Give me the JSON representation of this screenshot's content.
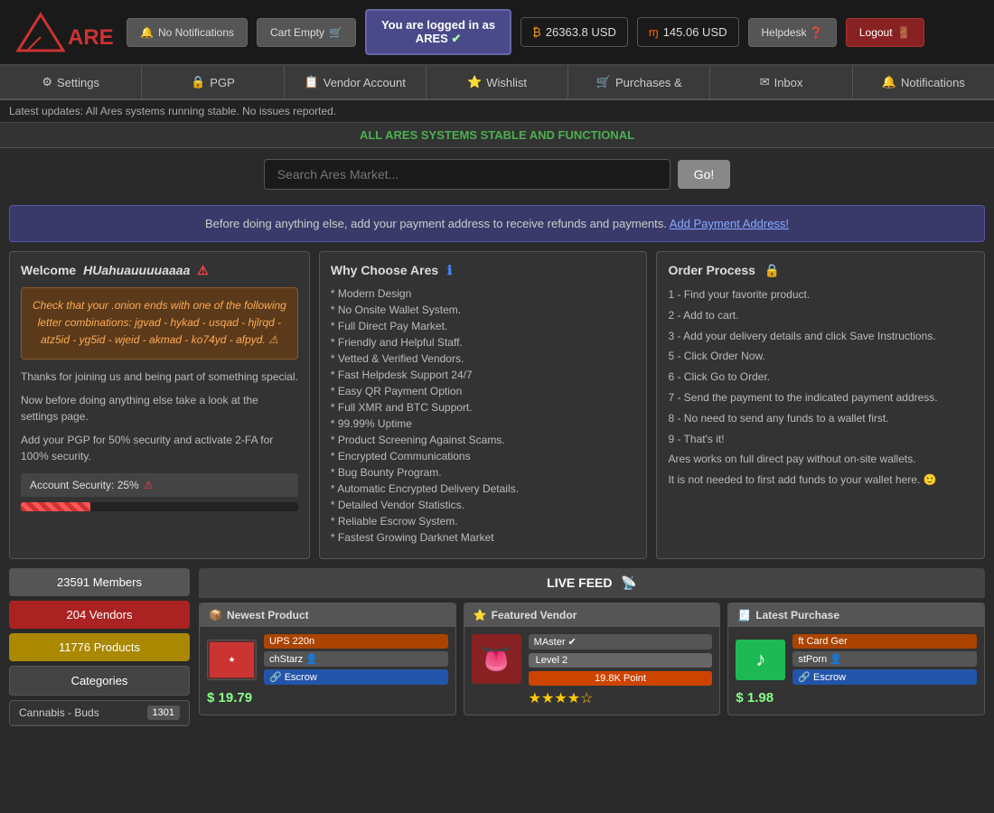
{
  "header": {
    "logo_text": "ARES",
    "notifications_label": "No Notifications",
    "cart_label": "Cart Empty",
    "logged_in_line1": "You are logged in as",
    "logged_in_line2": "ARES",
    "btc_balance": "26363.8 USD",
    "xmr_balance": "145.06 USD",
    "helpdesk_label": "Helpdesk",
    "logout_label": "Logout"
  },
  "nav": {
    "items": [
      {
        "label": "Settings",
        "icon": "⚙"
      },
      {
        "label": "PGP",
        "icon": "🔒"
      },
      {
        "label": "Vendor Account",
        "icon": "📋"
      },
      {
        "label": "Wishlist",
        "icon": "⭐"
      },
      {
        "label": "Purchases &",
        "icon": "🛒"
      },
      {
        "label": "Inbox",
        "icon": "✉"
      },
      {
        "label": "Notifications",
        "icon": "🔔"
      }
    ]
  },
  "ticker": {
    "text": "Latest updates: All Ares systems running stable. No issues reported."
  },
  "status_bar": {
    "text": "ALL ARES SYSTEMS STABLE AND FUNCTIONAL"
  },
  "search": {
    "placeholder": "Search Ares Market...",
    "go_label": "Go!"
  },
  "payment_notice": {
    "text_before": "Before doing anything else, add your payment address to receive refunds and payments.",
    "link_text": "Add Payment Address!"
  },
  "welcome": {
    "title": "Welcome",
    "username": "HUahuauuuuaaaa",
    "warning_text": "Check that your .onion ends with one of the following letter combinations: jgvad - hykad - usqad - hjlrqd - atz5id - yg5id - wjeid - akmad - ko74yd - afpyd. ⚠",
    "text1": "Thanks for joining us and being part of something special.",
    "text2": "Now before doing anything else take a look at the settings page.",
    "text3": "Add your PGP for 50% security and activate 2-FA for 100% security.",
    "security_label": "Account Security: 25%",
    "security_pct": 25
  },
  "why_choose": {
    "title": "Why Choose Ares",
    "items": [
      "* Modern Design",
      "* No Onsite Wallet System.",
      "* Full Direct Pay Market.",
      "* Friendly and Helpful Staff.",
      "* Vetted & Verified Vendors.",
      "* Fast Helpdesk Support 24/7",
      "* Easy QR Payment Option",
      "* Full XMR and BTC Support.",
      "* 99.99% Uptime",
      "* Product Screening Against Scams.",
      "* Encrypted Communications",
      "* Bug Bounty Program.",
      "* Automatic Encrypted Delivery Details.",
      "* Detailed Vendor Statistics.",
      "* Reliable Escrow System.",
      "* Fastest Growing Darknet Market"
    ]
  },
  "order_process": {
    "title": "Order Process",
    "steps": [
      "1 - Find your favorite product.",
      "2 - Add to cart.",
      "3 - Add your delivery details and click Save Instructions.",
      "5 - Click Order Now.",
      "6 - Click Go to Order.",
      "7 - Send the payment to the indicated payment address.",
      "8 - No need to send any funds to a wallet first.",
      "9 - That's it!",
      "Ares works on full direct pay without on-site wallets.",
      "It is not needed to first add funds to your wallet here. 🙂"
    ]
  },
  "stats": {
    "members": "23591 Members",
    "vendors": "204 Vendors",
    "products": "11776 Products",
    "categories_label": "Categories",
    "cat_list": [
      {
        "name": "Cannabis - Buds",
        "count": "1301"
      }
    ]
  },
  "live_feed": {
    "header": "LIVE FEED",
    "newest": {
      "label": "Newest Product",
      "product_title": "UPS 220n",
      "seller": "chStarz",
      "escrow": "Escrow",
      "price": "$ 19.79",
      "product_bg": "#553333"
    },
    "featured": {
      "label": "Featured Vendor",
      "vendor_name": "MAster",
      "level": "Level 2",
      "points": "19.8K Point",
      "stars": "★★★★☆"
    },
    "latest": {
      "label": "Latest Purchase",
      "product_title": "ft Card Ger",
      "seller": "stPorn",
      "escrow": "Escrow",
      "price": "$ 1.98",
      "product_bg": "#1DB954"
    }
  }
}
